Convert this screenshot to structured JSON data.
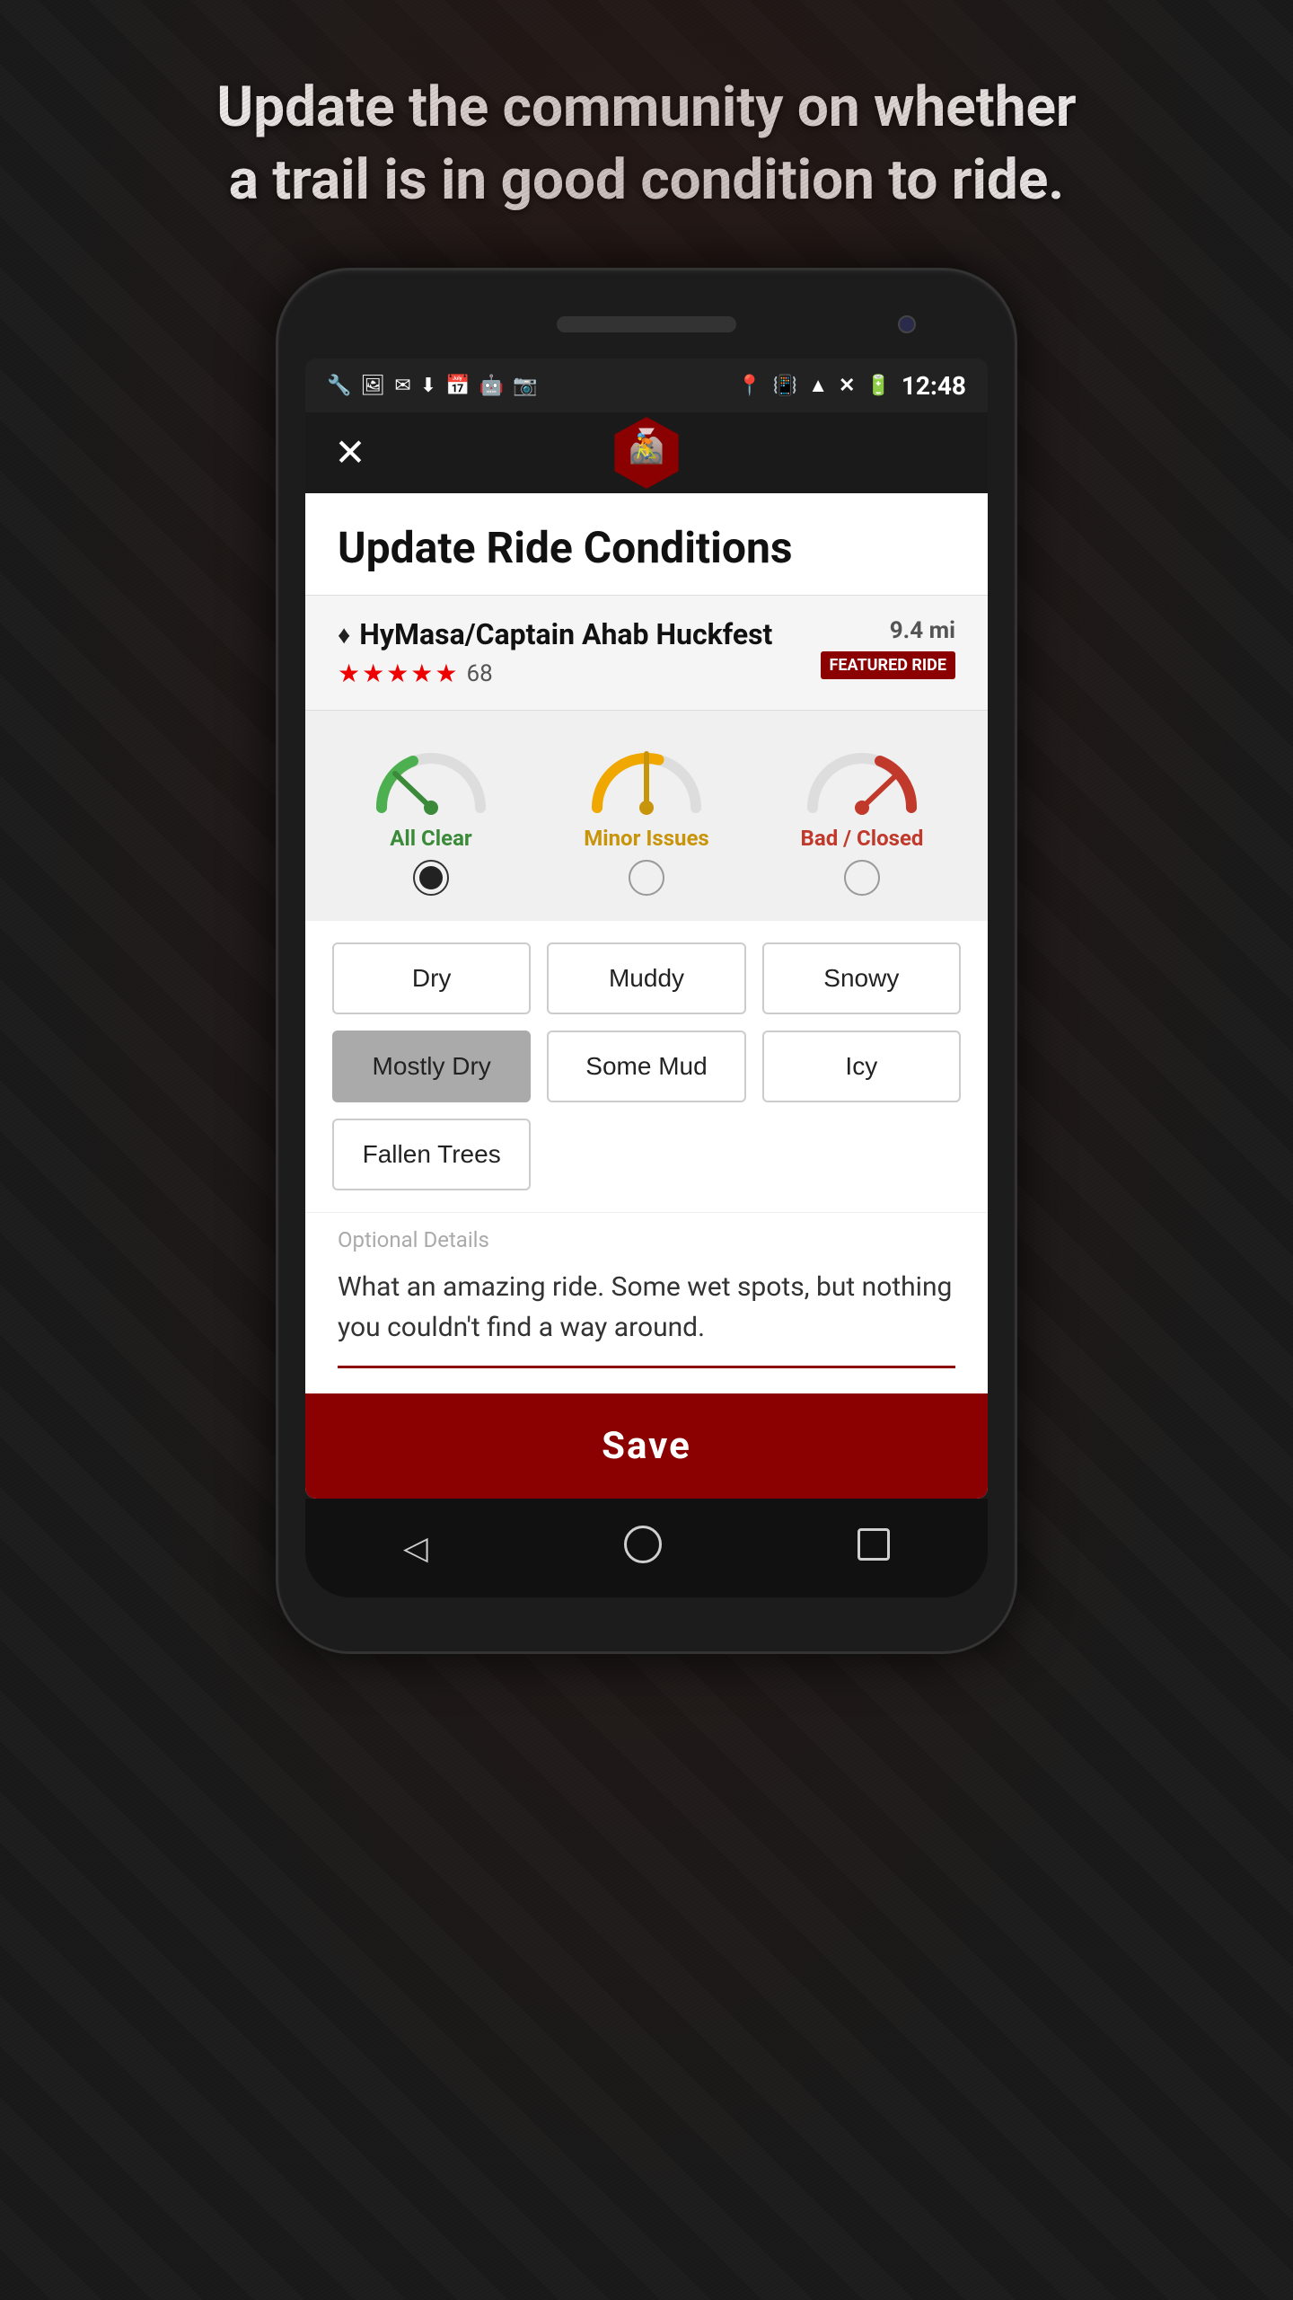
{
  "top_text": "Update the community on whether\na trail is in good condition to ride.",
  "status_bar": {
    "time": "12:48",
    "icons_left": [
      "wrench",
      "image",
      "gmail",
      "download",
      "calendar",
      "android",
      "camera"
    ],
    "icons_right": [
      "location",
      "vibrate",
      "wifi",
      "no-signal",
      "battery"
    ]
  },
  "toolbar": {
    "close_label": "✕"
  },
  "page_title": "Update Ride Conditions",
  "trail": {
    "name": "HyMasa/Captain Ahab Huckfest",
    "distance": "9.4 mi",
    "rating_stars": "★★★★★",
    "rating_count": "68",
    "featured_label": "FEATURED RIDE"
  },
  "conditions": [
    {
      "id": "all-clear",
      "label": "All Clear",
      "color": "green",
      "selected": true
    },
    {
      "id": "minor-issues",
      "label": "Minor Issues",
      "color": "yellow",
      "selected": false
    },
    {
      "id": "bad-closed",
      "label": "Bad / Closed",
      "color": "red",
      "selected": false
    }
  ],
  "condition_buttons": [
    {
      "id": "dry",
      "label": "Dry",
      "selected": false,
      "row": 1,
      "col": 1
    },
    {
      "id": "muddy",
      "label": "Muddy",
      "selected": false,
      "row": 1,
      "col": 2
    },
    {
      "id": "snowy",
      "label": "Snowy",
      "selected": false,
      "row": 1,
      "col": 3
    },
    {
      "id": "mostly-dry",
      "label": "Mostly Dry",
      "selected": true,
      "row": 2,
      "col": 1
    },
    {
      "id": "some-mud",
      "label": "Some Mud",
      "selected": false,
      "row": 2,
      "col": 2
    },
    {
      "id": "icy",
      "label": "Icy",
      "selected": false,
      "row": 2,
      "col": 3
    },
    {
      "id": "fallen-trees",
      "label": "Fallen Trees",
      "selected": false,
      "row": 3,
      "col": 1
    }
  ],
  "details": {
    "label": "Optional Details",
    "text": "What an amazing ride. Some wet spots, but nothing you couldn't find a way around."
  },
  "save_button": {
    "label": "Save"
  },
  "nav": {
    "back": "◁",
    "home": "○",
    "recent": "□"
  }
}
